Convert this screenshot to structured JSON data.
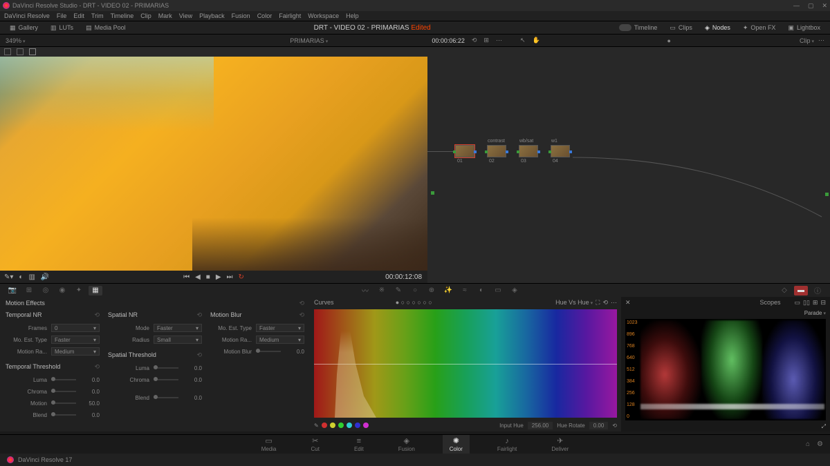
{
  "titlebar": {
    "text": "DaVinci Resolve Studio - DRT - VIDEO 02 - PRIMARIAS"
  },
  "menu": [
    "DaVinci Resolve",
    "File",
    "Edit",
    "Trim",
    "Timeline",
    "Clip",
    "Mark",
    "View",
    "Playback",
    "Fusion",
    "Color",
    "Fairlight",
    "Workspace",
    "Help"
  ],
  "toolbar": {
    "gallery": "Gallery",
    "luts": "LUTs",
    "media_pool": "Media Pool",
    "title": "DRT - VIDEO 02 - PRIMARIAS",
    "edited": "Edited",
    "timeline": "Timeline",
    "clips": "Clips",
    "nodes": "Nodes",
    "openfx": "Open FX",
    "lightbox": "Lightbox"
  },
  "secbar": {
    "zoom": "349%",
    "project": "PRIMARIAS",
    "timecode": "00:00:06:22",
    "clip": "Clip"
  },
  "transport": {
    "timecode": "00:00:12:08"
  },
  "nodes": [
    {
      "label": "",
      "num": "01"
    },
    {
      "label": "contrast",
      "num": "02"
    },
    {
      "label": "wb/sat",
      "num": "03"
    },
    {
      "label": "w1",
      "num": "04"
    }
  ],
  "motion": {
    "title": "Motion Effects",
    "temporal_nr": "Temporal NR",
    "spatial_nr": "Spatial NR",
    "motion_blur": "Motion Blur",
    "spatial_threshold": "Spatial Threshold",
    "temporal_threshold": "Temporal Threshold",
    "frames_label": "Frames",
    "frames_value": "0",
    "mo_est_label": "Mo. Est. Type",
    "mo_est_value": "Faster",
    "motion_ra_label": "Motion Ra...",
    "motion_ra_value": "Medium",
    "mode_label": "Mode",
    "mode_value": "Faster",
    "radius_label": "Radius",
    "radius_value": "Small",
    "mo_est2_label": "Mo. Est. Type",
    "mo_est2_value": "Faster",
    "motion_ra2_label": "Motion Ra...",
    "motion_ra2_value": "Medium",
    "motion_blur_label": "Motion Blur",
    "motion_blur_value": "0.0",
    "luma_label": "Luma",
    "luma_value": "0.0",
    "chroma_label": "Chroma",
    "chroma_value": "0.0",
    "blend_label": "Blend",
    "blend_value": "0.0",
    "luma2_label": "Luma",
    "luma2_value": "0.0",
    "chroma2_label": "Chroma",
    "chroma2_value": "0.0",
    "motion2_label": "Motion",
    "motion2_value": "50.0",
    "blend2_label": "Blend",
    "blend2_value": "0.0"
  },
  "curves": {
    "title": "Curves",
    "mode": "Hue Vs Hue",
    "input_hue_label": "Input Hue",
    "input_hue_value": "256.00",
    "hue_rotate_label": "Hue Rotate",
    "hue_rotate_value": "0.00"
  },
  "scopes": {
    "title": "Scopes",
    "mode": "Parade",
    "scale": [
      "1023",
      "896",
      "768",
      "640",
      "512",
      "384",
      "256",
      "128",
      "0"
    ]
  },
  "pages": [
    "Media",
    "Cut",
    "Edit",
    "Fusion",
    "Color",
    "Fairlight",
    "Deliver"
  ],
  "status": {
    "version": "DaVinci Resolve 17"
  }
}
